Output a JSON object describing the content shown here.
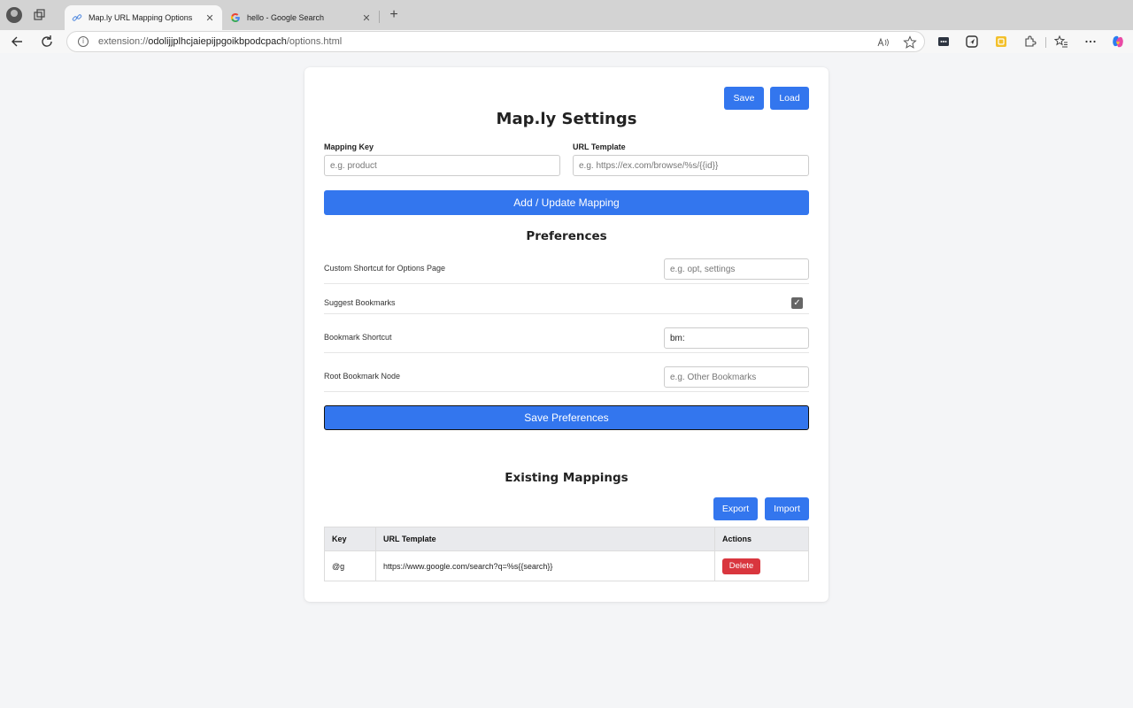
{
  "browser": {
    "tabs": [
      {
        "title": "Map.ly URL Mapping Options",
        "active": true
      },
      {
        "title": "hello - Google Search",
        "active": false
      }
    ],
    "url_scheme": "extension://",
    "url_host": "odolijjplhcjaiepijpgoikbpodcpach",
    "url_path": "/options.html",
    "close_glyph": "✕",
    "newtab_glyph": "+"
  },
  "header": {
    "save_label": "Save",
    "load_label": "Load",
    "title": "Map.ly Settings"
  },
  "mapping_form": {
    "key_label": "Mapping Key",
    "key_placeholder": "e.g. product",
    "template_label": "URL Template",
    "template_placeholder": "e.g. https://ex.com/browse/%s/{{id}}",
    "add_button": "Add / Update Mapping"
  },
  "preferences": {
    "title": "Preferences",
    "shortcut_label": "Custom Shortcut for Options Page",
    "shortcut_placeholder": "e.g. opt, settings",
    "suggest_label": "Suggest Bookmarks",
    "suggest_checked": true,
    "bookmark_shortcut_label": "Bookmark Shortcut",
    "bookmark_shortcut_value": "bm:",
    "root_node_label": "Root Bookmark Node",
    "root_node_placeholder": "e.g. Other Bookmarks",
    "save_button": "Save Preferences"
  },
  "mappings": {
    "title": "Existing Mappings",
    "export_label": "Export",
    "import_label": "Import",
    "columns": {
      "key": "Key",
      "template": "URL Template",
      "actions": "Actions"
    },
    "rows": [
      {
        "key": "@g",
        "template": "https://www.google.com/search?q=%s{{search}}",
        "action": "Delete"
      }
    ]
  },
  "colors": {
    "accent": "#3376ee",
    "danger": "#d9363e",
    "background": "#f4f5f7"
  }
}
